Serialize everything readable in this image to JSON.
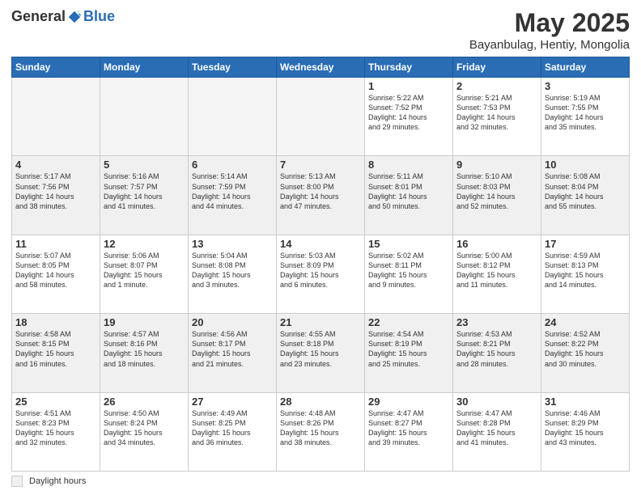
{
  "header": {
    "logo_general": "General",
    "logo_blue": "Blue",
    "title": "May 2025",
    "subtitle": "Bayanbulag, Hentiy, Mongolia"
  },
  "days_of_week": [
    "Sunday",
    "Monday",
    "Tuesday",
    "Wednesday",
    "Thursday",
    "Friday",
    "Saturday"
  ],
  "weeks": [
    [
      {
        "day": "",
        "info": ""
      },
      {
        "day": "",
        "info": ""
      },
      {
        "day": "",
        "info": ""
      },
      {
        "day": "",
        "info": ""
      },
      {
        "day": "1",
        "info": "Sunrise: 5:22 AM\nSunset: 7:52 PM\nDaylight: 14 hours\nand 29 minutes."
      },
      {
        "day": "2",
        "info": "Sunrise: 5:21 AM\nSunset: 7:53 PM\nDaylight: 14 hours\nand 32 minutes."
      },
      {
        "day": "3",
        "info": "Sunrise: 5:19 AM\nSunset: 7:55 PM\nDaylight: 14 hours\nand 35 minutes."
      }
    ],
    [
      {
        "day": "4",
        "info": "Sunrise: 5:17 AM\nSunset: 7:56 PM\nDaylight: 14 hours\nand 38 minutes."
      },
      {
        "day": "5",
        "info": "Sunrise: 5:16 AM\nSunset: 7:57 PM\nDaylight: 14 hours\nand 41 minutes."
      },
      {
        "day": "6",
        "info": "Sunrise: 5:14 AM\nSunset: 7:59 PM\nDaylight: 14 hours\nand 44 minutes."
      },
      {
        "day": "7",
        "info": "Sunrise: 5:13 AM\nSunset: 8:00 PM\nDaylight: 14 hours\nand 47 minutes."
      },
      {
        "day": "8",
        "info": "Sunrise: 5:11 AM\nSunset: 8:01 PM\nDaylight: 14 hours\nand 50 minutes."
      },
      {
        "day": "9",
        "info": "Sunrise: 5:10 AM\nSunset: 8:03 PM\nDaylight: 14 hours\nand 52 minutes."
      },
      {
        "day": "10",
        "info": "Sunrise: 5:08 AM\nSunset: 8:04 PM\nDaylight: 14 hours\nand 55 minutes."
      }
    ],
    [
      {
        "day": "11",
        "info": "Sunrise: 5:07 AM\nSunset: 8:05 PM\nDaylight: 14 hours\nand 58 minutes."
      },
      {
        "day": "12",
        "info": "Sunrise: 5:06 AM\nSunset: 8:07 PM\nDaylight: 15 hours\nand 1 minute."
      },
      {
        "day": "13",
        "info": "Sunrise: 5:04 AM\nSunset: 8:08 PM\nDaylight: 15 hours\nand 3 minutes."
      },
      {
        "day": "14",
        "info": "Sunrise: 5:03 AM\nSunset: 8:09 PM\nDaylight: 15 hours\nand 6 minutes."
      },
      {
        "day": "15",
        "info": "Sunrise: 5:02 AM\nSunset: 8:11 PM\nDaylight: 15 hours\nand 9 minutes."
      },
      {
        "day": "16",
        "info": "Sunrise: 5:00 AM\nSunset: 8:12 PM\nDaylight: 15 hours\nand 11 minutes."
      },
      {
        "day": "17",
        "info": "Sunrise: 4:59 AM\nSunset: 8:13 PM\nDaylight: 15 hours\nand 14 minutes."
      }
    ],
    [
      {
        "day": "18",
        "info": "Sunrise: 4:58 AM\nSunset: 8:15 PM\nDaylight: 15 hours\nand 16 minutes."
      },
      {
        "day": "19",
        "info": "Sunrise: 4:57 AM\nSunset: 8:16 PM\nDaylight: 15 hours\nand 18 minutes."
      },
      {
        "day": "20",
        "info": "Sunrise: 4:56 AM\nSunset: 8:17 PM\nDaylight: 15 hours\nand 21 minutes."
      },
      {
        "day": "21",
        "info": "Sunrise: 4:55 AM\nSunset: 8:18 PM\nDaylight: 15 hours\nand 23 minutes."
      },
      {
        "day": "22",
        "info": "Sunrise: 4:54 AM\nSunset: 8:19 PM\nDaylight: 15 hours\nand 25 minutes."
      },
      {
        "day": "23",
        "info": "Sunrise: 4:53 AM\nSunset: 8:21 PM\nDaylight: 15 hours\nand 28 minutes."
      },
      {
        "day": "24",
        "info": "Sunrise: 4:52 AM\nSunset: 8:22 PM\nDaylight: 15 hours\nand 30 minutes."
      }
    ],
    [
      {
        "day": "25",
        "info": "Sunrise: 4:51 AM\nSunset: 8:23 PM\nDaylight: 15 hours\nand 32 minutes."
      },
      {
        "day": "26",
        "info": "Sunrise: 4:50 AM\nSunset: 8:24 PM\nDaylight: 15 hours\nand 34 minutes."
      },
      {
        "day": "27",
        "info": "Sunrise: 4:49 AM\nSunset: 8:25 PM\nDaylight: 15 hours\nand 36 minutes."
      },
      {
        "day": "28",
        "info": "Sunrise: 4:48 AM\nSunset: 8:26 PM\nDaylight: 15 hours\nand 38 minutes."
      },
      {
        "day": "29",
        "info": "Sunrise: 4:47 AM\nSunset: 8:27 PM\nDaylight: 15 hours\nand 39 minutes."
      },
      {
        "day": "30",
        "info": "Sunrise: 4:47 AM\nSunset: 8:28 PM\nDaylight: 15 hours\nand 41 minutes."
      },
      {
        "day": "31",
        "info": "Sunrise: 4:46 AM\nSunset: 8:29 PM\nDaylight: 15 hours\nand 43 minutes."
      }
    ]
  ],
  "footer": {
    "daylight_label": "Daylight hours"
  },
  "colors": {
    "header_bg": "#2a6db5",
    "shaded_bg": "#f0f0f0"
  }
}
